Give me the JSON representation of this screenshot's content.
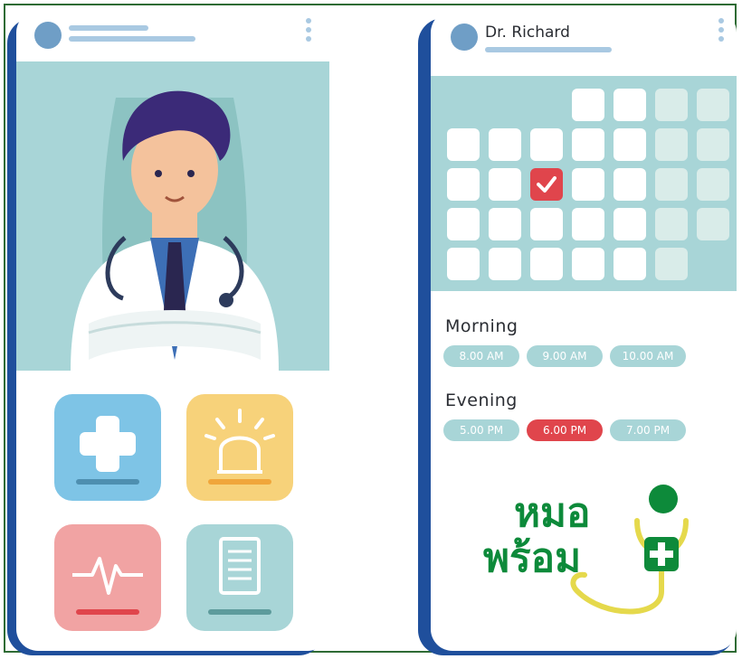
{
  "doctor_profile": {
    "name": "Dr. Richard"
  },
  "schedule": {
    "morning_label": "Morning",
    "morning_slots": [
      "8.00 AM",
      "9.00 AM",
      "10.00 AM"
    ],
    "evening_label": "Evening",
    "evening_slots": [
      "5.00 PM",
      "6.00 PM",
      "7.00 PM"
    ],
    "selected_slot": "6.00 PM"
  },
  "logo": {
    "line1": "หมอ",
    "line2": "พร้อม"
  },
  "menu_tiles": [
    {
      "icon": "medical-cross-icon",
      "color": "#7ec4e6"
    },
    {
      "icon": "alarm-siren-icon",
      "color": "#f7d27a"
    },
    {
      "icon": "heartbeat-icon",
      "color": "#f1a3a3"
    },
    {
      "icon": "document-icon",
      "color": "#a8d5d7"
    }
  ],
  "colors": {
    "accent_red": "#e0454c",
    "teal": "#a8d5d7",
    "phone_edge": "#1f4f9c",
    "logo_green": "#0d8a3a"
  }
}
